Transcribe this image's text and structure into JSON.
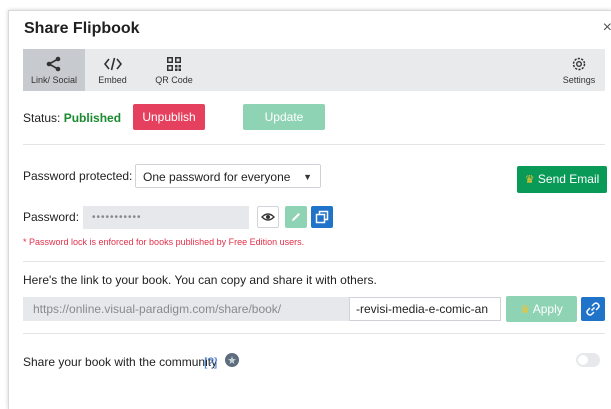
{
  "dialog": {
    "title": "Share Flipbook",
    "close_glyph": "×"
  },
  "tabs": [
    {
      "label": "Link/ Social",
      "icon": "share-icon",
      "active": true
    },
    {
      "label": "Embed",
      "icon": "code-icon",
      "active": false
    },
    {
      "label": "QR Code",
      "icon": "qr-code-icon",
      "active": false
    },
    {
      "label": "Settings",
      "icon": "gear-icon",
      "active": false
    }
  ],
  "status": {
    "label": "Status:",
    "value": "Published",
    "value_color": "#1a8a2e"
  },
  "buttons": {
    "unpublish": "Unpublish",
    "update": "Update",
    "send_email": "Send Email",
    "apply": "Apply"
  },
  "password": {
    "protected_label": "Password protected:",
    "mode": "One password for everyone",
    "label": "Password:",
    "masked_value": "•••••••••••",
    "note": "* Password lock is enforced for books published by Free Edition users."
  },
  "link": {
    "intro": "Here's the link to your book. You can copy and share it with others.",
    "base_url": "https://online.visual-paradigm.com/share/book/",
    "slug": "-revisi-media-e-comic-an"
  },
  "community": {
    "label": "Share your book with the community",
    "help": "[?]",
    "enabled": false
  },
  "colors": {
    "red": "#e5405e",
    "green": "#0a9a58",
    "mint": "#8fd3b5",
    "blue": "#1f73c9"
  }
}
